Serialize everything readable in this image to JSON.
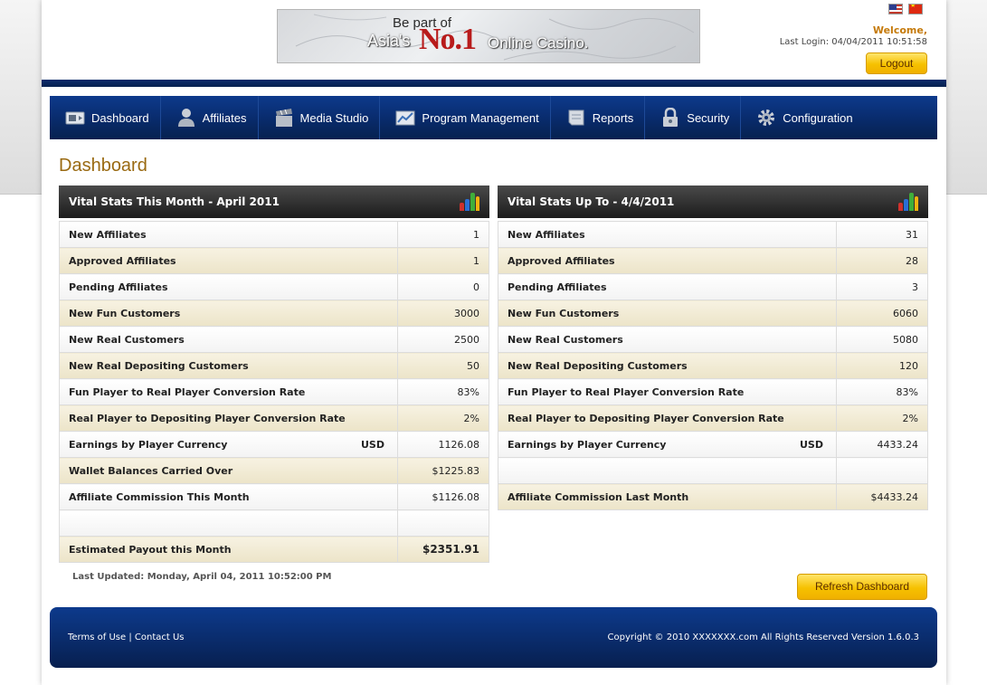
{
  "header": {
    "banner": {
      "line1": "Be part of",
      "line2": "Asia's",
      "line3": "No.1",
      "line4": "Online Casino."
    },
    "welcome": "Welcome,",
    "last_login": "Last Login: 04/04/2011 10:51:58",
    "logout_label": "Logout"
  },
  "nav": {
    "items": [
      {
        "label": "Dashboard",
        "icon": "dashboard-icon"
      },
      {
        "label": "Affiliates",
        "icon": "affiliates-icon"
      },
      {
        "label": "Media Studio",
        "icon": "clapperboard-icon"
      },
      {
        "label": "Program Management",
        "icon": "chart-icon"
      },
      {
        "label": "Reports",
        "icon": "reports-icon"
      },
      {
        "label": "Security",
        "icon": "lock-icon"
      },
      {
        "label": "Configuration",
        "icon": "gear-icon"
      }
    ]
  },
  "page_title": "Dashboard",
  "left_panel": {
    "title": "Vital Stats This Month - April 2011",
    "rows": [
      {
        "label": "New Affiliates",
        "value": "1"
      },
      {
        "label": "Approved Affiliates",
        "value": "1"
      },
      {
        "label": "Pending Affiliates",
        "value": "0"
      },
      {
        "label": "New Fun Customers",
        "value": "3000"
      },
      {
        "label": "New Real Customers",
        "value": "2500"
      },
      {
        "label": "New Real Depositing Customers",
        "value": "50"
      },
      {
        "label": "Fun Player to Real Player Conversion Rate",
        "value": "83%"
      },
      {
        "label": "Real Player to Depositing Player Conversion Rate",
        "value": "2%"
      },
      {
        "label": "Earnings by Player Currency",
        "currency": "USD",
        "value": "1126.08"
      },
      {
        "label": "Wallet Balances Carried Over",
        "value": "$1225.83"
      },
      {
        "label": "Affiliate Commission This Month",
        "value": "$1126.08"
      },
      {
        "label": "",
        "value": ""
      },
      {
        "label": "Estimated Payout this Month",
        "value": "$2351.91"
      }
    ]
  },
  "right_panel": {
    "title": "Vital Stats Up To - 4/4/2011",
    "rows": [
      {
        "label": "New Affiliates",
        "value": "31"
      },
      {
        "label": "Approved Affiliates",
        "value": "28"
      },
      {
        "label": "Pending Affiliates",
        "value": "3"
      },
      {
        "label": "New Fun Customers",
        "value": "6060"
      },
      {
        "label": "New Real Customers",
        "value": "5080"
      },
      {
        "label": "New Real Depositing Customers",
        "value": "120"
      },
      {
        "label": "Fun Player to Real Player Conversion Rate",
        "value": "83%"
      },
      {
        "label": "Real Player to Depositing Player Conversion Rate",
        "value": "2%"
      },
      {
        "label": "Earnings by Player Currency",
        "currency": "USD",
        "value": "4433.24"
      },
      {
        "label": "",
        "value": ""
      },
      {
        "label": "Affiliate Commission Last Month",
        "value": "$4433.24"
      }
    ]
  },
  "last_updated": "Last Updated: Monday, April 04, 2011 10:52:00 PM",
  "refresh_label": "Refresh Dashboard",
  "footer": {
    "terms": "Terms of Use",
    "separator": "|",
    "contact": "Contact Us",
    "copyright": "Copyright © 2010 XXXXXXX.com All Rights Reserved  Version 1.6.0.3"
  },
  "colors": {
    "nav_blue": "#092c6e",
    "gold_button": "#f6c100",
    "title_brown": "#9a6a12",
    "welcome_orange": "#c57a0b"
  }
}
